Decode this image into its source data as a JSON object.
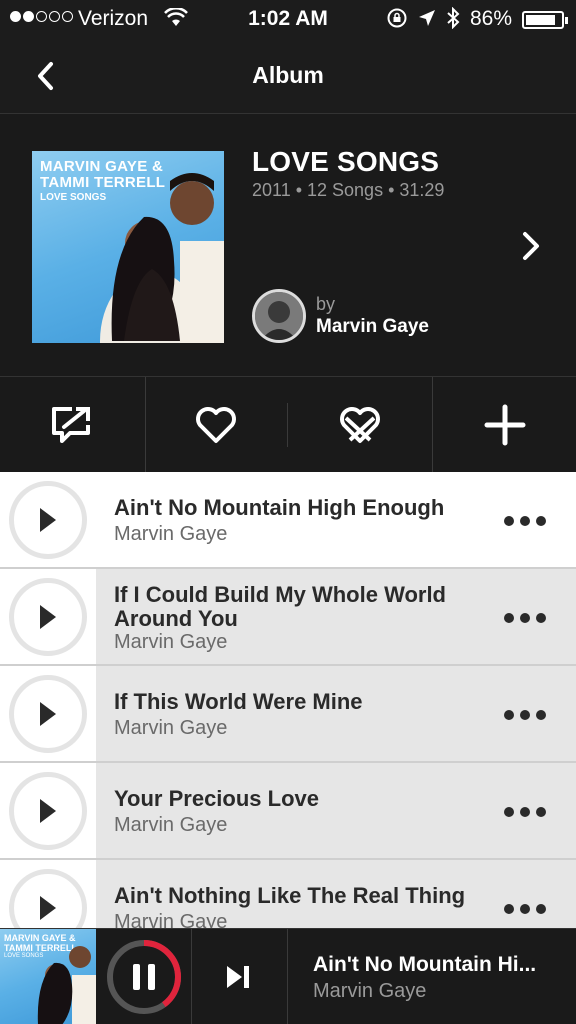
{
  "status_bar": {
    "signal_dots_filled": 2,
    "signal_dots_total": 5,
    "carrier": "Verizon",
    "time": "1:02 AM",
    "battery": "86%",
    "battery_level": 0.86
  },
  "nav": {
    "title": "Album"
  },
  "album": {
    "cover_text_line1": "MARVIN GAYE &",
    "cover_text_line2": "TAMMI TERRELL",
    "cover_text_sub": "LOVE SONGS",
    "title": "LOVE SONGS",
    "meta": "2011 • 12 Songs • 31:29",
    "by_label": "by",
    "artist": "Marvin Gaye"
  },
  "actions": [
    {
      "icon": "share-icon"
    },
    {
      "icon": "heart-icon"
    },
    {
      "icon": "broken-heart-icon"
    },
    {
      "icon": "plus-icon"
    }
  ],
  "tracks": [
    {
      "title": "Ain't No Mountain High Enough",
      "artist": "Marvin Gaye",
      "active": true
    },
    {
      "title": "If I Could Build My Whole World Around You",
      "artist": "Marvin Gaye",
      "active": false
    },
    {
      "title": "If This World Were Mine",
      "artist": "Marvin Gaye",
      "active": false
    },
    {
      "title": "Your Precious Love",
      "artist": "Marvin Gaye",
      "active": false
    },
    {
      "title": "Ain't Nothing Like The Real Thing",
      "artist": "Marvin Gaye",
      "active": false
    }
  ],
  "now_playing": {
    "cover_text_line1": "MARVIN GAYE &",
    "cover_text_line2": "TAMMI TERRELL",
    "cover_text_sub": "LOVE SONGS",
    "title": "Ain't No Mountain Hi...",
    "artist": "Marvin Gaye",
    "progress": 0.4,
    "accent_color": "#e0243c"
  }
}
